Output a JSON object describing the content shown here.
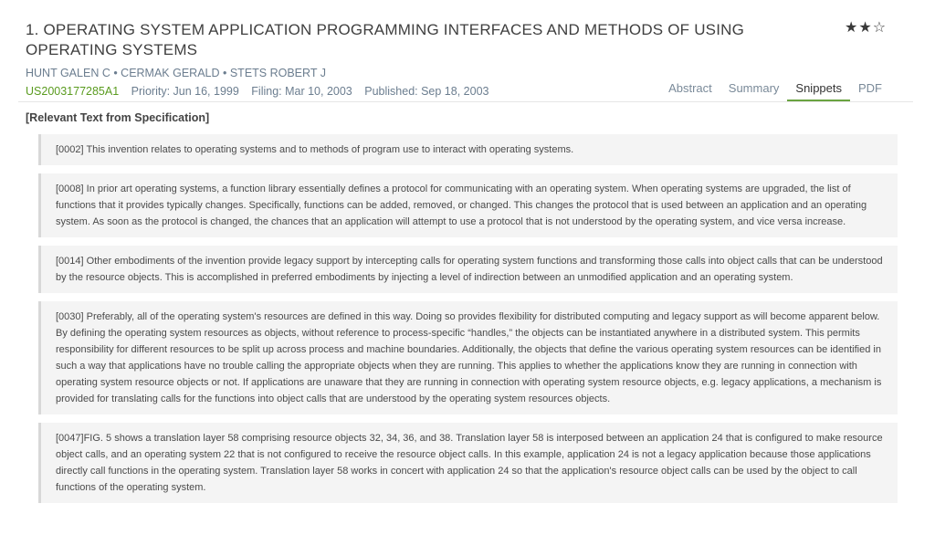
{
  "result": {
    "title": "1. OPERATING SYSTEM APPLICATION PROGRAMMING INTERFACES AND METHODS OF USING OPERATING SYSTEMS",
    "rating": {
      "filled": 2,
      "total": 3,
      "filled_glyph": "★",
      "empty_glyph": "☆"
    },
    "authors": "HUNT GALEN C • CERMAK GERALD • STETS ROBERT J",
    "pub_number": "US2003177285A1",
    "priority": "Priority: Jun 16, 1999",
    "filing": "Filing: Mar 10, 2003",
    "published": "Published: Sep 18, 2003",
    "accent_color": "#5a9b1f"
  },
  "tabs": [
    {
      "label": "Abstract",
      "active": false
    },
    {
      "label": "Summary",
      "active": false
    },
    {
      "label": "Snippets",
      "active": true
    },
    {
      "label": "PDF",
      "active": false
    }
  ],
  "section_heading": "[Relevant Text from Specification]",
  "snippets": [
    "[0002] This invention relates to operating systems and to methods of program use to interact with operating systems.",
    "[0008] In prior art operating systems, a function library essentially defines a protocol for communicating with an operating system. When operating systems are upgraded, the list of functions that it provides typically changes. Specifically, functions can be added, removed, or changed. This changes the protocol that is used between an application and an operating system. As soon as the protocol is changed, the chances that an application will attempt to use a protocol that is not understood by the operating system, and vice versa increase.",
    "[0014] Other embodiments of the invention provide legacy support by intercepting calls for operating system functions and transforming those calls into object calls that can be understood by the resource objects. This is accomplished in preferred embodiments by injecting a level of indirection between an unmodified application and an operating system.",
    "[0030] Preferably, all of the operating system's resources are defined in this way. Doing so provides flexibility for distributed computing and legacy support as will become apparent below. By defining the operating system resources as objects, without reference to process-specific “handles,” the objects can be instantiated anywhere in a distributed system. This permits responsibility for different resources to be split up across process and machine boundaries. Additionally, the objects that define the various operating system resources can be identified in such a way that applications have no trouble calling the appropriate objects when they are running. This applies to whether the applications know they are running in connection with operating system resource objects or not. If applications are unaware that they are running in connection with operating system resource objects, e.g. legacy applications, a mechanism is provided for translating calls for the functions into object calls that are understood by the operating system resources objects.",
    "[0047]FIG. 5 shows a translation layer 58 comprising resource objects 32, 34, 36, and 38. Translation layer 58 is interposed between an application 24 that is configured to make resource object calls, and an operating system 22 that is not configured to receive the resource object calls. In this example, application 24 is not a legacy application because those applications directly call functions in the operating system. Translation layer 58 works in concert with application 24 so that the application's resource object calls can be used by the object to call functions of the operating system."
  ]
}
